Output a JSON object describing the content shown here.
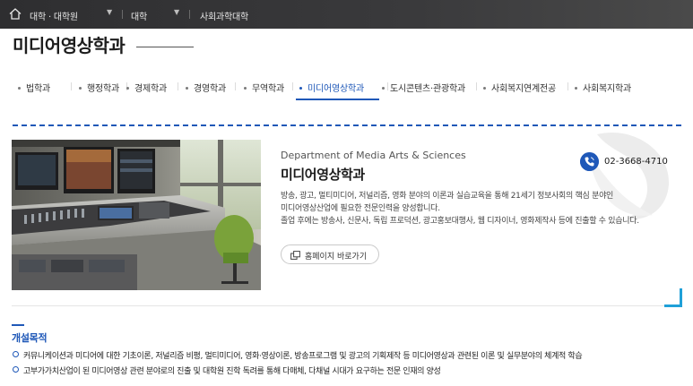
{
  "breadcrumb": {
    "home_icon": "home-icon",
    "items": [
      "대학 · 대학원",
      "대학",
      "사회과학대학"
    ]
  },
  "page": {
    "title": "미디어영상학과"
  },
  "tabs": [
    {
      "label": "법학과",
      "active": false
    },
    {
      "label": "행정학과",
      "active": false
    },
    {
      "label": "경제학과",
      "active": false
    },
    {
      "label": "경영학과",
      "active": false
    },
    {
      "label": "무역학과",
      "active": false
    },
    {
      "label": "미디어영상학과",
      "active": true
    },
    {
      "label": "도시콘텐츠·관광학과",
      "active": false
    },
    {
      "label": "사회복지연계전공",
      "active": false
    },
    {
      "label": "사회복지학과",
      "active": false
    }
  ],
  "department": {
    "name_en": "Department of Media Arts & Sciences",
    "name_kr": "미디어영상학과",
    "phone": "02-3668-4710",
    "phone_icon": "phone-icon",
    "description": [
      "방송, 광고, 멀티미디어, 저널리즘, 영화 분야의 이론과 실습교육을 통해 21세기 정보사회의 핵심 분야인",
      "미디어영상산업에 필요한 전문인력을 양성합니다.",
      "졸업 후에는 방송사, 신문사, 독립 프로덕션, 광고홍보대행사, 웹 디자이너, 영화제작사 등에 진출할 수 있습니다."
    ],
    "homepage_button": "홈페이지 바로가기",
    "homepage_icon": "external-link-icon",
    "photo_icon": "broadcast-studio-photo"
  },
  "purpose": {
    "title": "개설목적",
    "items": [
      "커뮤니케이션과 미디어에 대한 기초이론, 저널리즘 비평, 멀티미디어, 영화·영상이론, 방송프로그램 및 광고의 기획제작 등 미디어영상과 관련된 이론 및 실무분야의 체계적 학습",
      "고부가가치산업이 된 미디어영상 관련 분야로의 진출 및 대학원 진학 독려를 통해 다매체, 다채널 시대가 요구하는 전문 인재의 양성"
    ]
  },
  "colors": {
    "accent": "#1f58b8",
    "corner_accent": "#1fa0d8",
    "topbar": "#333335"
  }
}
